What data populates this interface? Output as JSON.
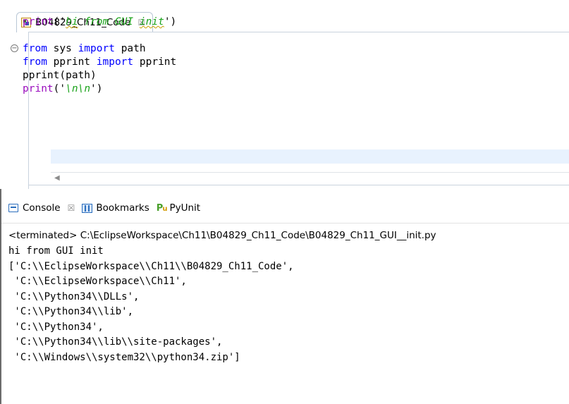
{
  "editor": {
    "tab_label": "B04829_Ch11_Code",
    "close_glyph": "☒",
    "fold_glyph": "⊖",
    "lines": [
      {
        "tokens": [
          {
            "t": "fn",
            "v": "print"
          },
          {
            "t": "plain",
            "v": "('"
          },
          {
            "t": "str err",
            "v": "hi"
          },
          {
            "t": "str",
            "v": " from GUI "
          },
          {
            "t": "str err",
            "v": "init"
          },
          {
            "t": "plain",
            "v": "')"
          }
        ]
      },
      {
        "tokens": []
      },
      {
        "fold": true,
        "tokens": [
          {
            "t": "kw",
            "v": "from"
          },
          {
            "t": "plain",
            "v": " sys "
          },
          {
            "t": "kw",
            "v": "import"
          },
          {
            "t": "plain",
            "v": " path"
          }
        ]
      },
      {
        "tokens": [
          {
            "t": "kw",
            "v": "from"
          },
          {
            "t": "plain",
            "v": " pprint "
          },
          {
            "t": "kw",
            "v": "import"
          },
          {
            "t": "plain",
            "v": " pprint"
          }
        ]
      },
      {
        "tokens": [
          {
            "t": "plain",
            "v": "pprint(path)"
          }
        ]
      },
      {
        "tokens": [
          {
            "t": "fn",
            "v": "print"
          },
          {
            "t": "plain",
            "v": "('"
          },
          {
            "t": "str",
            "v": "\\n\\n"
          },
          {
            "t": "plain",
            "v": "')"
          }
        ]
      }
    ],
    "scroll_left_glyph": "◀"
  },
  "console": {
    "tabs": [
      {
        "name": "console",
        "label": "Console",
        "close_glyph": "☒"
      },
      {
        "name": "bookmarks",
        "label": "Bookmarks"
      },
      {
        "name": "pyunit",
        "label": "PyUnit"
      }
    ],
    "status": "<terminated> C:\\EclipseWorkspace\\Ch11\\B04829_Ch11_Code\\B04829_Ch11_GUI__init.py",
    "output": [
      "hi from GUI init",
      "['C:\\\\EclipseWorkspace\\\\Ch11\\\\B04829_Ch11_Code',",
      " 'C:\\\\EclipseWorkspace\\\\Ch11',",
      " 'C:\\\\Python34\\\\DLLs',",
      " 'C:\\\\Python34\\\\lib',",
      " 'C:\\\\Python34',",
      " 'C:\\\\Python34\\\\lib\\\\site-packages',",
      " 'C:\\\\Windows\\\\system32\\\\python34.zip']"
    ]
  },
  "colors": {
    "keyword": "#0000ff",
    "function": "#9a0dbd",
    "string": "#1ba31b",
    "current_line": "#e8f2fe",
    "console_icon": "#2c6ebd"
  }
}
